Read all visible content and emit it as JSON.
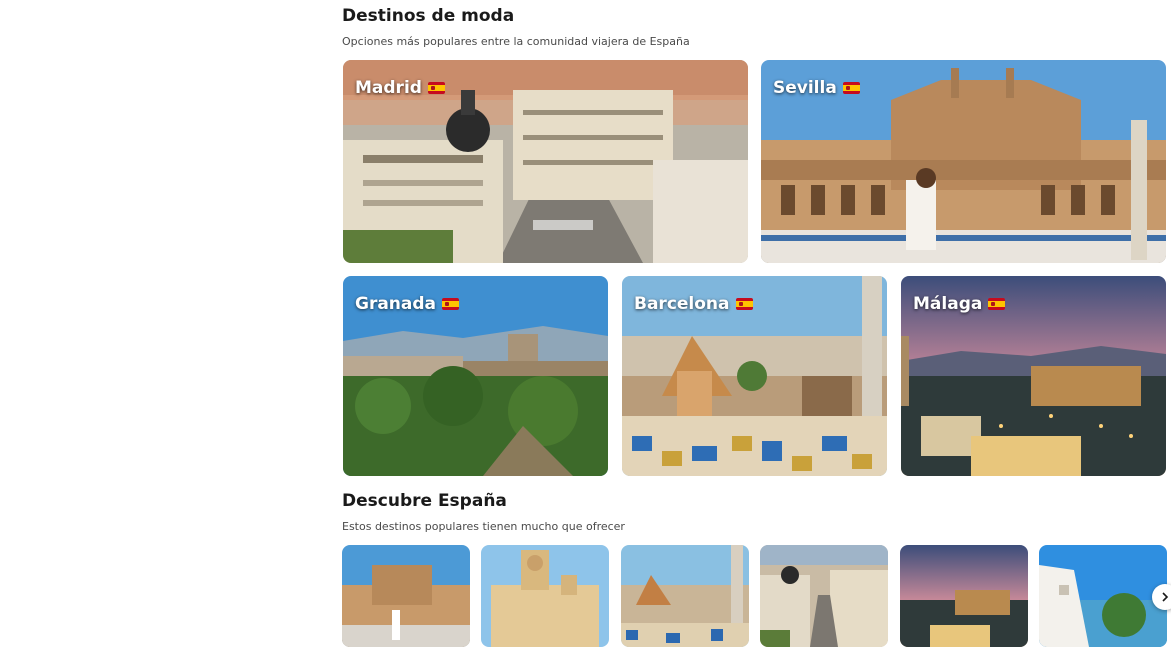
{
  "trending": {
    "title": "Destinos de moda",
    "subtitle": "Opciones más populares entre la comunidad viajera de España",
    "cards": [
      {
        "name": "Madrid"
      },
      {
        "name": "Sevilla"
      },
      {
        "name": "Granada"
      },
      {
        "name": "Barcelona"
      },
      {
        "name": "Málaga"
      }
    ]
  },
  "discover": {
    "title": "Descubre España",
    "subtitle": "Estos destinos populares tienen mucho que ofrecer",
    "thumbnails": [
      "plaza",
      "ayuntamiento",
      "park-guell",
      "gran-via",
      "malaga-dusk",
      "coast"
    ]
  },
  "icons": {
    "flag": "spain-flag-icon",
    "next": "chevron-right-icon"
  },
  "colors": {
    "title": "#1a1a1a",
    "subtitle": "#4a4a4a"
  }
}
